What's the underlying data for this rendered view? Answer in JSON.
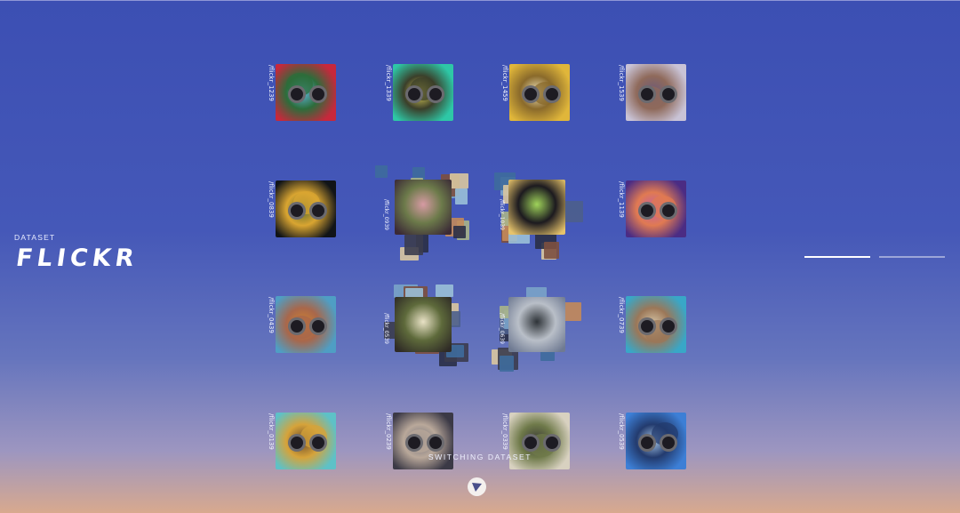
{
  "dataset": {
    "label": "DATASET",
    "name": "FLICKR"
  },
  "status": {
    "switching_text": "SWITCHING DATASET"
  },
  "grid_tiles": [
    {
      "caption": "/flickr_1239",
      "c1": "#c7283c",
      "c2": "#2c6d3b",
      "c3": "#5fb3d9"
    },
    {
      "caption": "/flickr_1339",
      "c1": "#2ec7a6",
      "c2": "#3b3f2a",
      "c3": "#e7d65a"
    },
    {
      "caption": "/flickr_1459",
      "c1": "#e0b63a",
      "c2": "#8a6a2b",
      "c3": "#f1e6c0"
    },
    {
      "caption": "/flickr_1539",
      "c1": "#c9c3d6",
      "c2": "#8f6a5b",
      "c3": "#6b5a7a"
    },
    {
      "caption": "/flickr_0839",
      "c1": "#111418",
      "c2": "#d9a531",
      "c3": "#5a6b2f"
    },
    {
      "caption": "/flickr_1139",
      "c1": "#4b2c84",
      "c2": "#e07a52",
      "c3": "#c25fa3"
    },
    {
      "caption": "/flickr_0439",
      "c1": "#4f9ec4",
      "c2": "#a8674b",
      "c3": "#d2842f"
    },
    {
      "caption": "/flickr_0739",
      "c1": "#39a7c7",
      "c2": "#9b7758",
      "c3": "#d7c7a8"
    },
    {
      "caption": "/flickr_0139",
      "c1": "#5ec1c7",
      "c2": "#d6a33a",
      "c3": "#6b4a2a"
    },
    {
      "caption": "/flickr_0239",
      "c1": "#3b3946",
      "c2": "#b9a89a",
      "c3": "#70707b"
    },
    {
      "caption": "/flickr_0339",
      "c1": "#d8d1c0",
      "c2": "#6f7a4a",
      "c3": "#3a3a36"
    },
    {
      "caption": "/flickr_0539",
      "c1": "#3d7fd6",
      "c2": "#233b6e",
      "c3": "#a7c7e8"
    }
  ],
  "cluster_captions": [
    "/flickr_0939",
    "/flickr_1039",
    "/flickr_0539",
    "/flickr_0639"
  ],
  "icons": {
    "logo": "circle-triangle-logo-icon"
  }
}
